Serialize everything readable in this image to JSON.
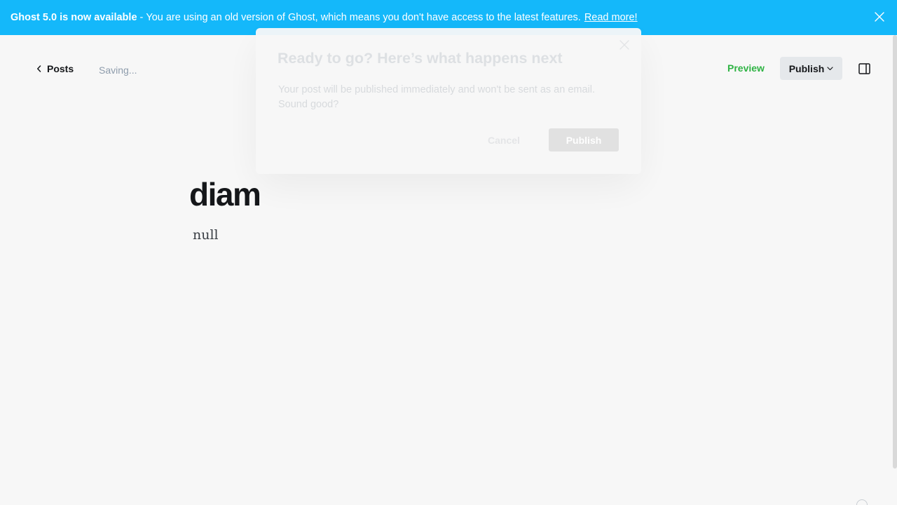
{
  "banner": {
    "strong_text": "Ghost 5.0 is now available",
    "separator": "-",
    "message": "You are using an old version of Ghost, which means you don't have access to the latest features.",
    "link_label": "Read more!",
    "close_icon": "close-icon"
  },
  "header": {
    "back_label": "Posts",
    "back_icon": "chevron-left-icon",
    "status": "Saving...",
    "preview_label": "Preview",
    "publish_label": "Publish",
    "publish_icon": "chevron-down-icon",
    "settings_icon": "sidebar-toggle-icon"
  },
  "post": {
    "title": "diam",
    "body": "null"
  },
  "modal": {
    "title": "Ready to go? Here’s what happens next",
    "message": "Your post will be published immediately and won't be sent as an email. Sound good?",
    "cancel_label": "Cancel",
    "confirm_label": "Publish",
    "close_icon": "close-icon"
  },
  "colors": {
    "banner_bg": "#14b8fa",
    "preview_green": "#2fb344",
    "page_bg": "#f7f7f7"
  }
}
